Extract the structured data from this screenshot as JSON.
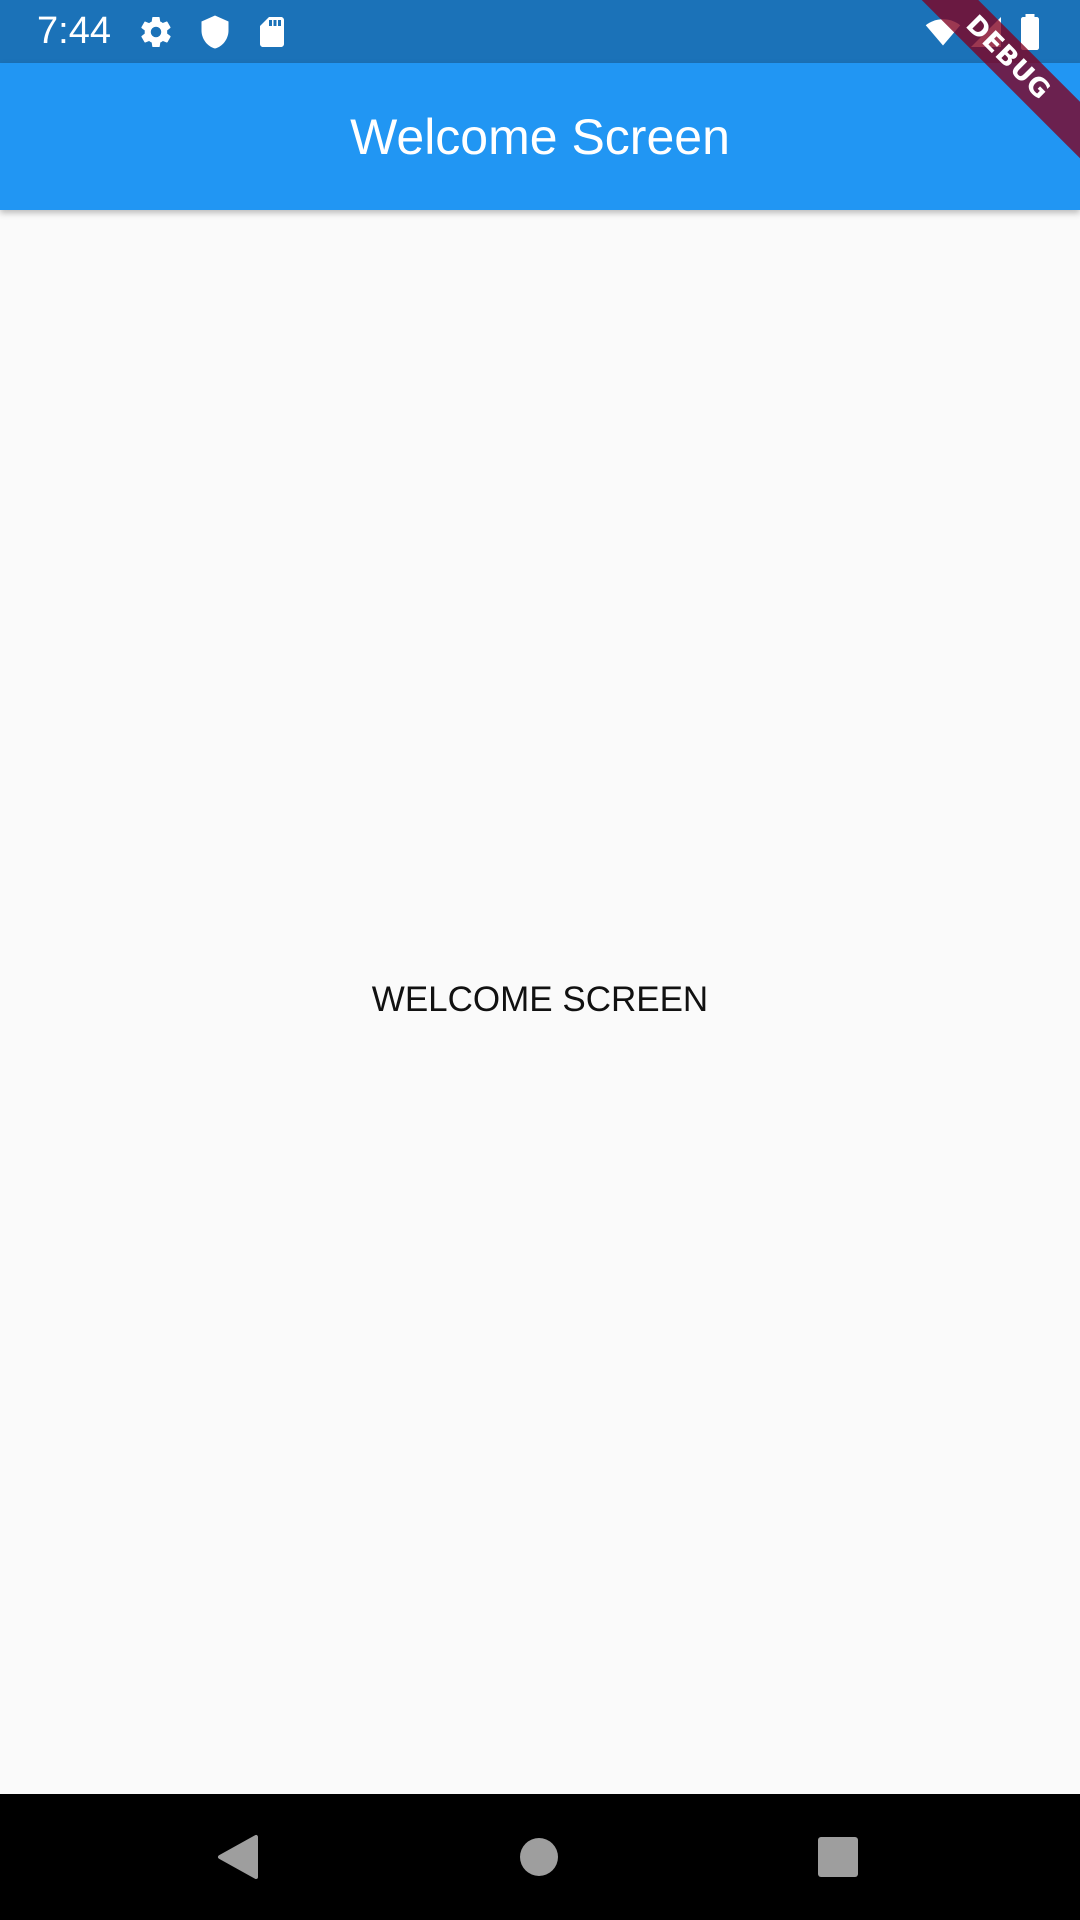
{
  "status_bar": {
    "time": "7:44",
    "icons_left": [
      "settings-icon",
      "shield-icon",
      "sd-card-icon"
    ],
    "icons_right": [
      "wifi-icon",
      "signal-icon",
      "battery-icon"
    ],
    "background": "#1b72b8"
  },
  "app_bar": {
    "title": "Welcome Screen",
    "background": "#2196f3"
  },
  "debug_banner": {
    "label": "DEBUG"
  },
  "body": {
    "center_text": "WELCOME SCREEN",
    "background": "#fafafa"
  },
  "nav_bar": {
    "buttons": [
      "back-icon",
      "home-icon",
      "recents-icon"
    ]
  }
}
